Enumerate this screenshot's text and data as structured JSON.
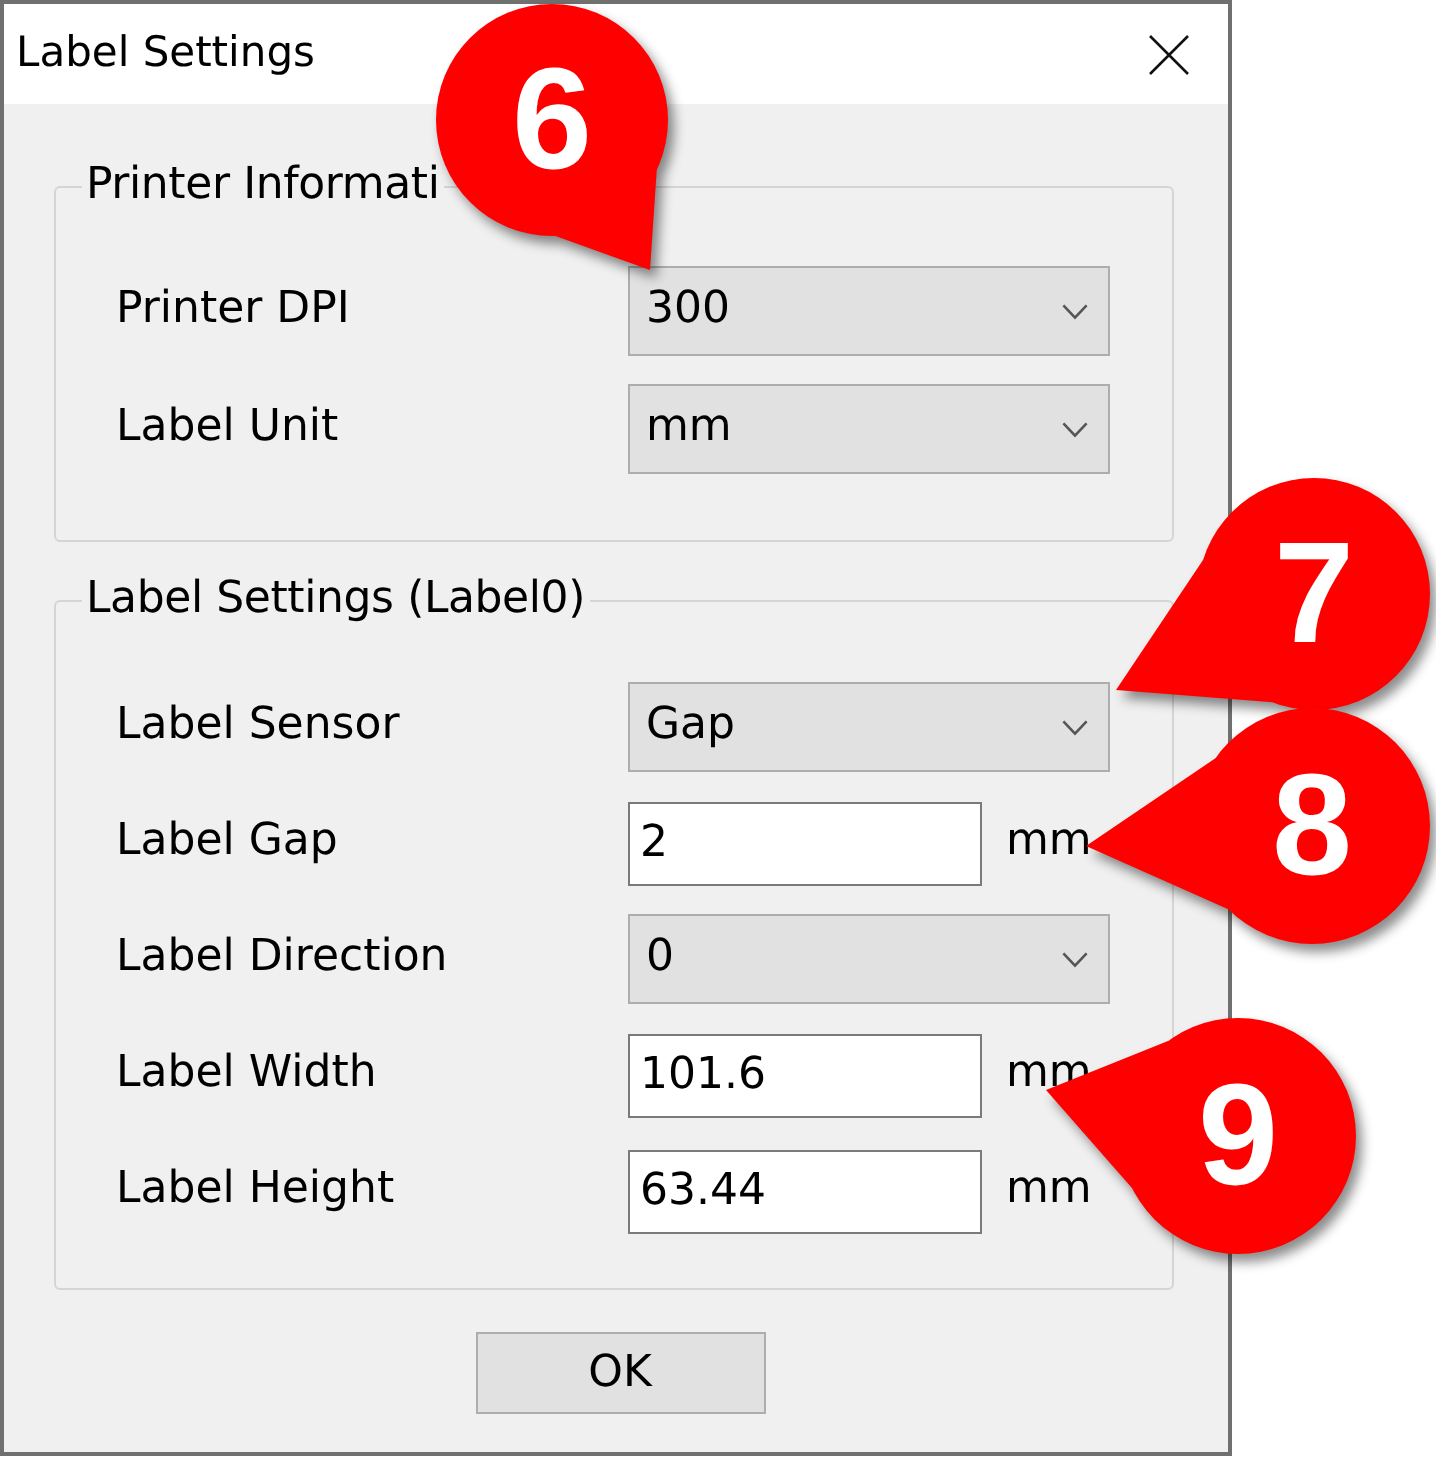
{
  "window": {
    "title": "Label Settings"
  },
  "groups": [
    {
      "title": "Printer Informati",
      "fields": [
        {
          "kind": "dropdown",
          "label": "Printer DPI",
          "value": "300"
        },
        {
          "kind": "dropdown",
          "label": "Label Unit",
          "value": "mm"
        }
      ]
    },
    {
      "title": "Label Settings (Label0)",
      "fields": [
        {
          "kind": "dropdown",
          "label": "Label Sensor",
          "value": "Gap"
        },
        {
          "kind": "textbox",
          "label": "Label Gap",
          "value": "2",
          "unit": "mm"
        },
        {
          "kind": "dropdown",
          "label": "Label Direction",
          "value": "0"
        },
        {
          "kind": "textbox",
          "label": "Label Width",
          "value": "101.6",
          "unit": "mm"
        },
        {
          "kind": "textbox",
          "label": "Label Height",
          "value": "63.44",
          "unit": "mm"
        }
      ]
    }
  ],
  "buttons": [
    "OK"
  ],
  "callouts": [
    "6",
    "7",
    "8",
    "9"
  ]
}
